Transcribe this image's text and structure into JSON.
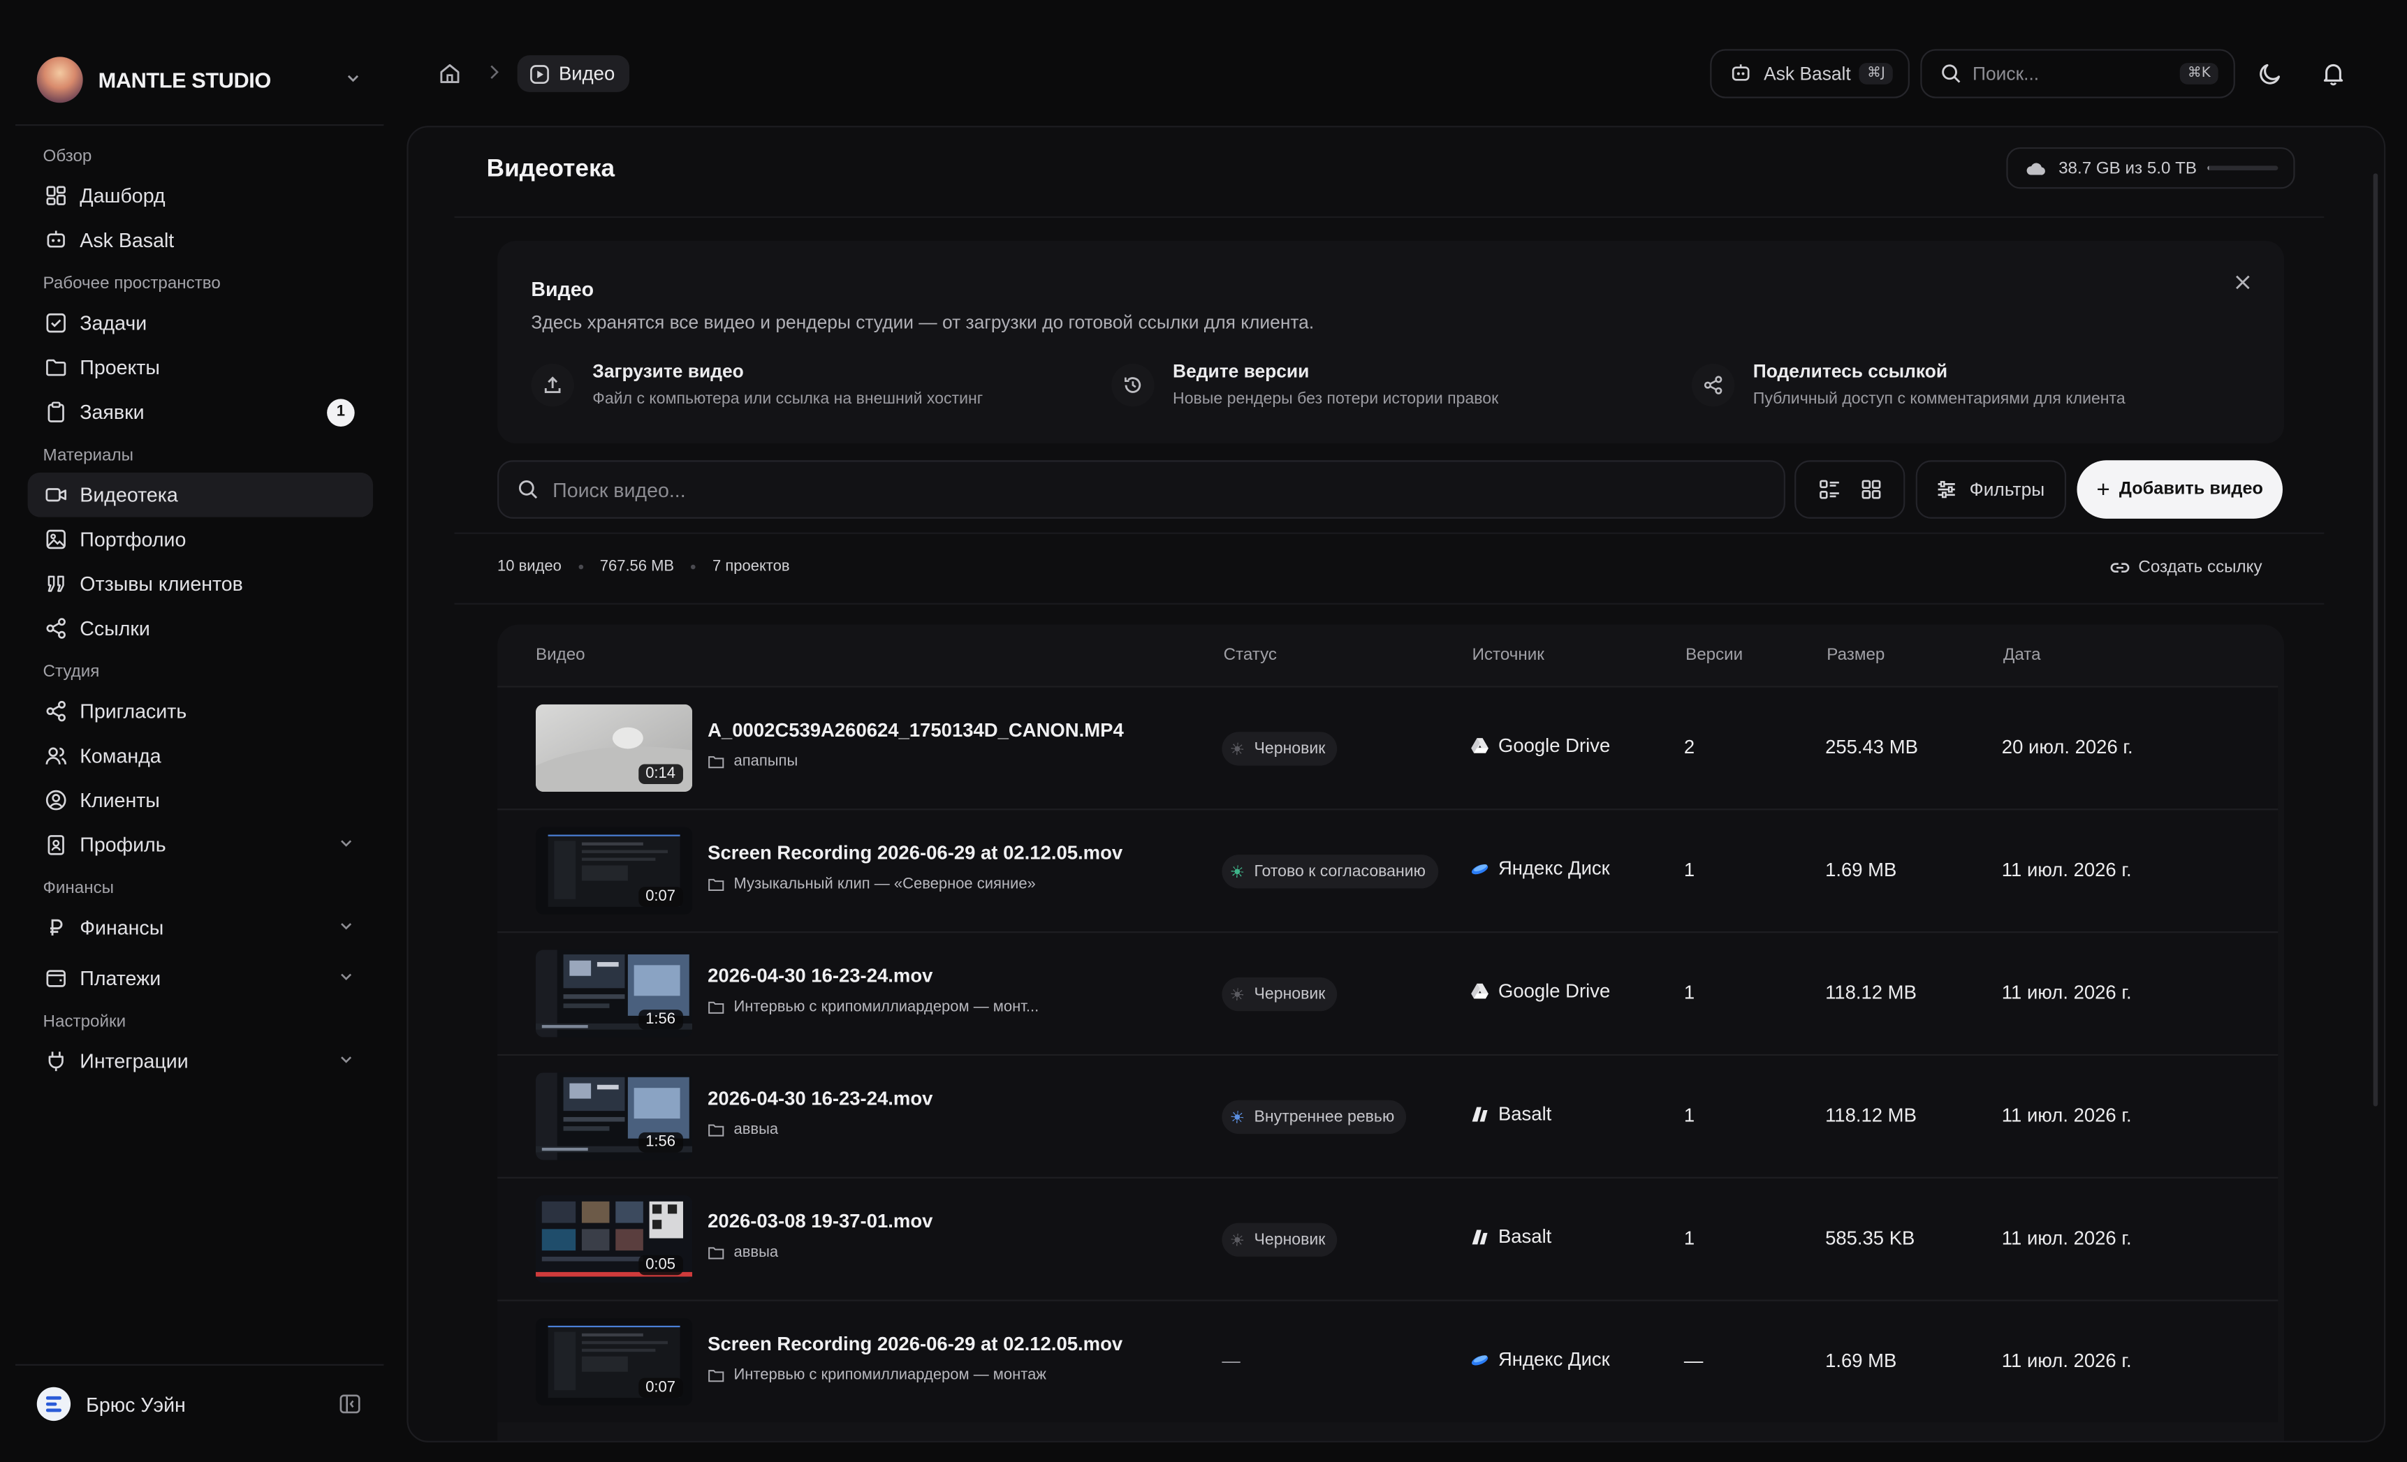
{
  "brand": {
    "name": "MANTLE STUDIO"
  },
  "sidebar": {
    "sections": [
      {
        "title": "Обзор",
        "items": [
          {
            "label": "Дашборд",
            "icon": "dashboard-icon"
          },
          {
            "label": "Ask Basalt",
            "icon": "bot-icon"
          }
        ]
      },
      {
        "title": "Рабочее пространство",
        "items": [
          {
            "label": "Задачи",
            "icon": "checkbox-icon"
          },
          {
            "label": "Проекты",
            "icon": "folder-icon"
          },
          {
            "label": "Заявки",
            "icon": "clipboard-icon",
            "badge": "1"
          }
        ]
      },
      {
        "title": "Материалы",
        "items": [
          {
            "label": "Видеотека",
            "icon": "video-icon",
            "active": true
          },
          {
            "label": "Портфолио",
            "icon": "image-icon"
          },
          {
            "label": "Отзывы клиентов",
            "icon": "quote-icon"
          },
          {
            "label": "Ссылки",
            "icon": "share-icon"
          }
        ]
      },
      {
        "title": "Студия",
        "items": [
          {
            "label": "Пригласить",
            "icon": "share-icon"
          },
          {
            "label": "Команда",
            "icon": "team-icon"
          },
          {
            "label": "Клиенты",
            "icon": "user-circle-icon"
          },
          {
            "label": "Профиль",
            "icon": "id-card-icon",
            "chevron": true
          }
        ]
      },
      {
        "title": "Финансы",
        "items": [
          {
            "label": "Финансы",
            "icon": "ruble-icon",
            "chevron": true
          },
          {
            "label": "Платежи",
            "icon": "wallet-icon",
            "chevron": true
          }
        ]
      },
      {
        "title": "Настройки",
        "items": [
          {
            "label": "Интеграции",
            "icon": "plug-icon",
            "chevron": true
          }
        ]
      }
    ],
    "user": {
      "name": "Брюс Уэйн"
    }
  },
  "topbar": {
    "breadcrumb_current": "Видео",
    "ask_label": "Ask Basalt",
    "ask_shortcut": "⌘J",
    "search_placeholder": "Поиск...",
    "search_shortcut": "⌘K"
  },
  "page": {
    "title": "Видеотека",
    "storage": {
      "label": "38.7 GB из 5.0 TB",
      "used_fraction": 0.0077
    }
  },
  "info": {
    "title": "Видео",
    "desc": "Здесь хранятся все видео и рендеры студии — от загрузки до готовой ссылки для клиента.",
    "features": [
      {
        "title": "Загрузите видео",
        "desc": "Файл с компьютера или ссылка на внешний хостинг",
        "icon": "upload-icon"
      },
      {
        "title": "Ведите версии",
        "desc": "Новые рендеры без потери истории правок",
        "icon": "history-icon"
      },
      {
        "title": "Поделитесь ссылкой",
        "desc": "Публичный доступ с комментариями для клиента",
        "icon": "share-icon"
      }
    ]
  },
  "toolbar": {
    "search_placeholder": "Поиск видео...",
    "filters_label": "Фильтры",
    "add_label": "Добавить видео"
  },
  "stats": {
    "count": "10 видео",
    "size": "767.56 MB",
    "projects": "7 проектов",
    "create_link": "Создать ссылку"
  },
  "table": {
    "columns": [
      "Видео",
      "Статус",
      "Источник",
      "Версии",
      "Размер",
      "Дата"
    ],
    "rows": [
      {
        "name": "A_0002C539A260624_1750134D_CANON.MP4",
        "project": "апапыпы",
        "duration": "0:14",
        "status": "Черновик",
        "status_color": "#5a5a60",
        "source": "Google Drive",
        "source_icon": "google-drive-icon",
        "versions": "2",
        "size": "255.43 MB",
        "date": "20 июл. 2026 г.",
        "thumb": "light"
      },
      {
        "name": "Screen Recording 2026-06-29 at 02.12.05.mov",
        "project": "Музыкальный клип — «Северное сияние»",
        "duration": "0:07",
        "status": "Готово к согласованию",
        "status_color": "#3fb58a",
        "source": "Яндекс Диск",
        "source_icon": "yandex-disk-icon",
        "versions": "1",
        "size": "1.69 MB",
        "date": "11 июл. 2026 г.",
        "thumb": "dark"
      },
      {
        "name": "2026-04-30 16-23-24.mov",
        "project": "Интервью с крипомиллиардером — монт...",
        "duration": "1:56",
        "status": "Черновик",
        "status_color": "#5a5a60",
        "source": "Google Drive",
        "source_icon": "google-drive-icon",
        "versions": "1",
        "size": "118.12 MB",
        "date": "11 июл. 2026 г.",
        "thumb": "screen"
      },
      {
        "name": "2026-04-30 16-23-24.mov",
        "project": "аввыа",
        "duration": "1:56",
        "status": "Внутреннее ревью",
        "status_color": "#5b8fe0",
        "source": "Basalt",
        "source_icon": "basalt-icon",
        "versions": "1",
        "size": "118.12 MB",
        "date": "11 июл. 2026 г.",
        "thumb": "screen"
      },
      {
        "name": "2026-03-08 19-37-01.mov",
        "project": "аввыа",
        "duration": "0:05",
        "status": "Черновик",
        "status_color": "#5a5a60",
        "source": "Basalt",
        "source_icon": "basalt-icon",
        "versions": "1",
        "size": "585.35 KB",
        "date": "11 июл. 2026 г.",
        "thumb": "grid"
      },
      {
        "name": "Screen Recording 2026-06-29 at 02.12.05.mov",
        "project": "Интервью с крипомиллиардером — монтаж",
        "duration": "0:07",
        "status": "—",
        "status_color": "",
        "source": "Яндекс Диск",
        "source_icon": "yandex-disk-icon",
        "versions": "—",
        "size": "1.69 MB",
        "date": "11 июл. 2026 г.",
        "thumb": "dark"
      }
    ]
  }
}
